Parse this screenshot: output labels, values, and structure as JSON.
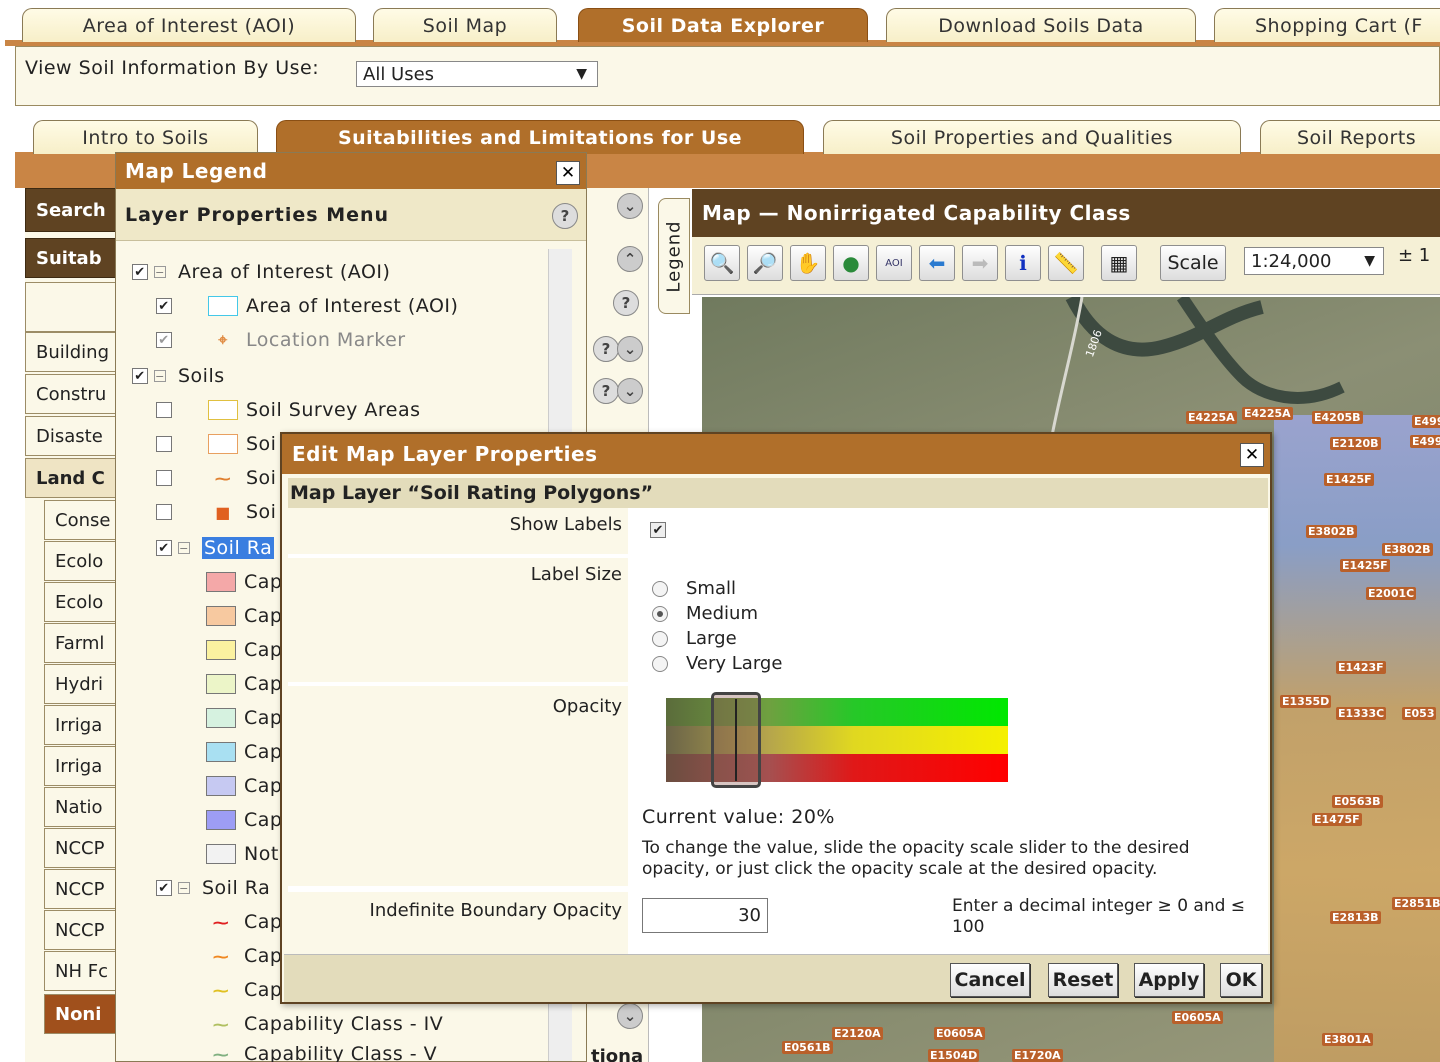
{
  "top_tabs": [
    "Area of Interest (AOI)",
    "Soil Map",
    "Soil Data Explorer",
    "Download Soils Data",
    "Shopping Cart (F"
  ],
  "view_by_use": {
    "label": "View Soil Information By Use:",
    "value": "All Uses"
  },
  "sub_tabs": [
    "Intro to Soils",
    "Suitabilities and Limitations for Use",
    "Soil Properties and Qualities",
    "Soil Reports"
  ],
  "left_accordion": {
    "search": "Search",
    "suitab": "Suitab",
    "items": [
      "Building",
      "Constru",
      "Disaste"
    ],
    "land": "Land C",
    "sub_items": [
      "Conse",
      "Ecolo",
      "Ecolo",
      "Farml",
      "Hydri",
      "Irriga",
      "Irriga",
      "Natio",
      "NCCP",
      "NCCP",
      "NCCP",
      "NH Fc"
    ],
    "selected": "Noni"
  },
  "map": {
    "title": "Map — Nonirrigated Capability Class",
    "scale_button": "Scale",
    "scale_value": "1:24,000",
    "plus_minus": "± 1",
    "road_label": "1806",
    "legend_tab": "Legend",
    "labels": [
      "E4225A",
      "E4225A",
      "E4205B",
      "E499",
      "E2120B",
      "E499",
      "E1425F",
      "E3802B",
      "E3802B",
      "E1425F",
      "E2001C",
      "E1423F",
      "E1355D",
      "E1333C",
      "E053",
      "E1475F",
      "E0563B",
      "E2851B",
      "E2813B",
      "E0605A",
      "E2120A",
      "E0605A",
      "E1504D",
      "E1720A",
      "E3801A",
      "E0561B"
    ]
  },
  "legend": {
    "title": "Map Legend",
    "menu": "Layer Properties Menu",
    "close": "✕",
    "help": "?",
    "aoi_group": "Area of Interest (AOI)",
    "aoi_item": "Area of Interest (AOI)",
    "marker_item": "Location Marker",
    "soils_group": "Soils",
    "soil_items": [
      "Soil Survey Areas",
      "Soi",
      "Soi",
      "Soi"
    ],
    "soil_rating_group": "Soil Ra",
    "cap_items": [
      "Cap",
      "Cap",
      "Cap",
      "Cap",
      "Cap",
      "Cap",
      "Cap",
      "Cap"
    ],
    "not_item": "Not",
    "soil_rating_group2": "Soil Ra",
    "line_items": [
      "Cap",
      "Cap",
      "Cap",
      "Capability Class - IV",
      "Capability Class - V"
    ],
    "swatch_colors": [
      "#f4a8a8",
      "#f7c9a0",
      "#fbf2a0",
      "#ecf5c8",
      "#d6f2e0",
      "#a9e0f2",
      "#c6c9f2",
      "#9d9df5",
      "#f2f2f2"
    ],
    "line_colors": [
      "#e02020",
      "#f08820",
      "#e0c020",
      "#b0c060",
      "#80b080"
    ]
  },
  "dialog": {
    "title": "Edit Map Layer Properties",
    "close": "✕",
    "subtitle": "Map Layer “Soil Rating Polygons”",
    "show_labels_label": "Show Labels",
    "label_size_label": "Label Size",
    "sizes": [
      "Small",
      "Medium",
      "Large",
      "Very Large"
    ],
    "selected_size": "Medium",
    "opacity_label": "Opacity",
    "current_value": "Current value: 20%",
    "opacity_value": 20,
    "help_text": "To change the value, slide the opacity scale slider to the desired opacity, or just click the opacity scale at the desired opacity.",
    "boundary_label": "Indefinite Boundary Opacity",
    "boundary_value": "30",
    "boundary_hint": "Enter a decimal integer ≥ 0 and ≤ 100",
    "buttons": {
      "cancel": "Cancel",
      "reset": "Reset",
      "apply": "Apply",
      "ok": "OK"
    }
  },
  "partial_text": {
    "under_dialog": "tiona"
  }
}
